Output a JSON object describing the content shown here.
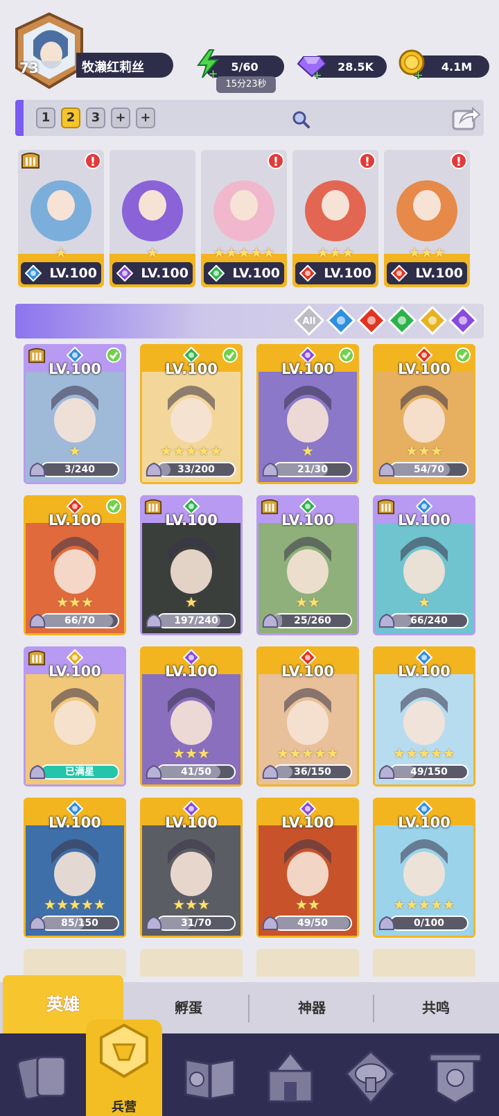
{
  "player": {
    "level": "73",
    "name": "牧濑红莉丝",
    "avatar_icon": "hero-portrait-icon"
  },
  "resources": {
    "energy": {
      "value": "5/60",
      "timer": "15分23秒",
      "icon": "lightning-icon",
      "color": "#43d24a"
    },
    "gems": {
      "value": "28.5K",
      "icon": "gem-icon",
      "color": "#8a5cf5"
    },
    "coins": {
      "value": "4.1M",
      "icon": "coin-icon",
      "color": "#f0b81a"
    }
  },
  "team_tabs": {
    "slots": [
      "1",
      "2",
      "3",
      "+",
      "+"
    ],
    "selected": "2"
  },
  "team": [
    {
      "level": "LV.100",
      "element": "water",
      "stars": "★",
      "alert": "!",
      "has_alert": true,
      "badge": true,
      "theme": "#6aa7d9"
    },
    {
      "level": "LV.100",
      "element": "dark",
      "stars": "★",
      "alert": "",
      "has_alert": false,
      "badge": false,
      "theme": "#7b4fd6"
    },
    {
      "level": "LV.100",
      "element": "nature",
      "stars": "★★★★★",
      "alert": "!",
      "has_alert": true,
      "badge": false,
      "theme": "#f4b3c9"
    },
    {
      "level": "LV.100",
      "element": "fire",
      "stars": "★★★",
      "alert": "!",
      "has_alert": true,
      "badge": false,
      "theme": "#e4523a"
    },
    {
      "level": "LV.100",
      "element": "fire",
      "stars": "★★★",
      "alert": "!",
      "has_alert": true,
      "badge": false,
      "theme": "#e87b2e"
    }
  ],
  "filters": {
    "all_label": "All",
    "elements": [
      "water",
      "fire",
      "nature",
      "light",
      "dark"
    ]
  },
  "element_colors": {
    "water": "#2f8fe0",
    "fire": "#e2331f",
    "nature": "#2bb34a",
    "light": "#e6b21e",
    "dark": "#8a4ae0"
  },
  "heroes": [
    {
      "level": "LV.100",
      "element": "water",
      "stars": "★",
      "progress": "3/240",
      "fraction": 0.0125,
      "checked": true,
      "badge": true,
      "frame": "purple",
      "theme": "#9fb9d9",
      "full": false
    },
    {
      "level": "LV.100",
      "element": "nature",
      "stars": "★★★★★",
      "progress": "33/200",
      "fraction": 0.165,
      "checked": true,
      "badge": false,
      "frame": "gold",
      "theme": "#f3d79a",
      "full": false
    },
    {
      "level": "LV.100",
      "element": "dark",
      "stars": "★",
      "progress": "21/30",
      "fraction": 0.7,
      "checked": true,
      "badge": false,
      "frame": "gold",
      "theme": "#8b78c9",
      "full": false
    },
    {
      "level": "LV.100",
      "element": "fire",
      "stars": "★★★",
      "progress": "54/70",
      "fraction": 0.77,
      "checked": true,
      "badge": false,
      "frame": "gold",
      "theme": "#e7b060",
      "full": false
    },
    {
      "level": "LV.100",
      "element": "fire",
      "stars": "★★★",
      "progress": "66/70",
      "fraction": 0.94,
      "checked": true,
      "badge": false,
      "frame": "gold",
      "theme": "#e06a3c",
      "full": false
    },
    {
      "level": "LV.100",
      "element": "nature",
      "stars": "★",
      "progress": "197/240",
      "fraction": 0.82,
      "checked": false,
      "badge": true,
      "frame": "purple",
      "theme": "#3b3f3c",
      "full": false
    },
    {
      "level": "LV.100",
      "element": "nature",
      "stars": "★★",
      "progress": "25/260",
      "fraction": 0.096,
      "checked": false,
      "badge": true,
      "frame": "purple",
      "theme": "#8fb07a",
      "full": false
    },
    {
      "level": "LV.100",
      "element": "water",
      "stars": "★",
      "progress": "66/240",
      "fraction": 0.275,
      "checked": false,
      "badge": true,
      "frame": "purple",
      "theme": "#6fc4cf",
      "full": false
    },
    {
      "level": "LV.100",
      "element": "light",
      "stars": "",
      "progress": "已满星",
      "fraction": 1,
      "checked": false,
      "badge": true,
      "frame": "purple",
      "theme": "#f1c77a",
      "full": true
    },
    {
      "level": "LV.100",
      "element": "dark",
      "stars": "★★★",
      "progress": "41/50",
      "fraction": 0.82,
      "checked": false,
      "badge": false,
      "frame": "gold",
      "theme": "#8a6fbf",
      "full": false
    },
    {
      "level": "LV.100",
      "element": "fire",
      "stars": "★★★★★",
      "progress": "36/150",
      "fraction": 0.24,
      "checked": false,
      "badge": false,
      "frame": "gold",
      "theme": "#e8c09a",
      "full": false
    },
    {
      "level": "LV.100",
      "element": "water",
      "stars": "★★★★★",
      "progress": "49/150",
      "fraction": 0.327,
      "checked": false,
      "badge": false,
      "frame": "gold",
      "theme": "#b8dcef",
      "full": false
    },
    {
      "level": "LV.100",
      "element": "water",
      "stars": "★★★★★",
      "progress": "85/150",
      "fraction": 0.567,
      "checked": false,
      "badge": false,
      "frame": "gold",
      "theme": "#3e6fa8",
      "full": false
    },
    {
      "level": "LV.100",
      "element": "dark",
      "stars": "★★★",
      "progress": "31/70",
      "fraction": 0.443,
      "checked": false,
      "badge": false,
      "frame": "gold",
      "theme": "#5b5d65",
      "full": false
    },
    {
      "level": "LV.100",
      "element": "dark",
      "stars": "★★",
      "progress": "49/50",
      "fraction": 0.98,
      "checked": false,
      "badge": false,
      "frame": "gold",
      "theme": "#c8532a",
      "full": false
    },
    {
      "level": "LV.100",
      "element": "water",
      "stars": "★★★★★",
      "progress": "0/100",
      "fraction": 0.0,
      "checked": false,
      "badge": false,
      "frame": "gold",
      "theme": "#9bd4ea",
      "full": false
    }
  ],
  "sub_tabs": [
    "英雄",
    "孵蛋",
    "神器",
    "共鸣"
  ],
  "bottom_nav": {
    "selected_label": "兵营",
    "icons": [
      "cards-icon",
      "barracks-icon",
      "book-icon",
      "castle-icon",
      "mushroom-icon",
      "banner-icon"
    ]
  }
}
